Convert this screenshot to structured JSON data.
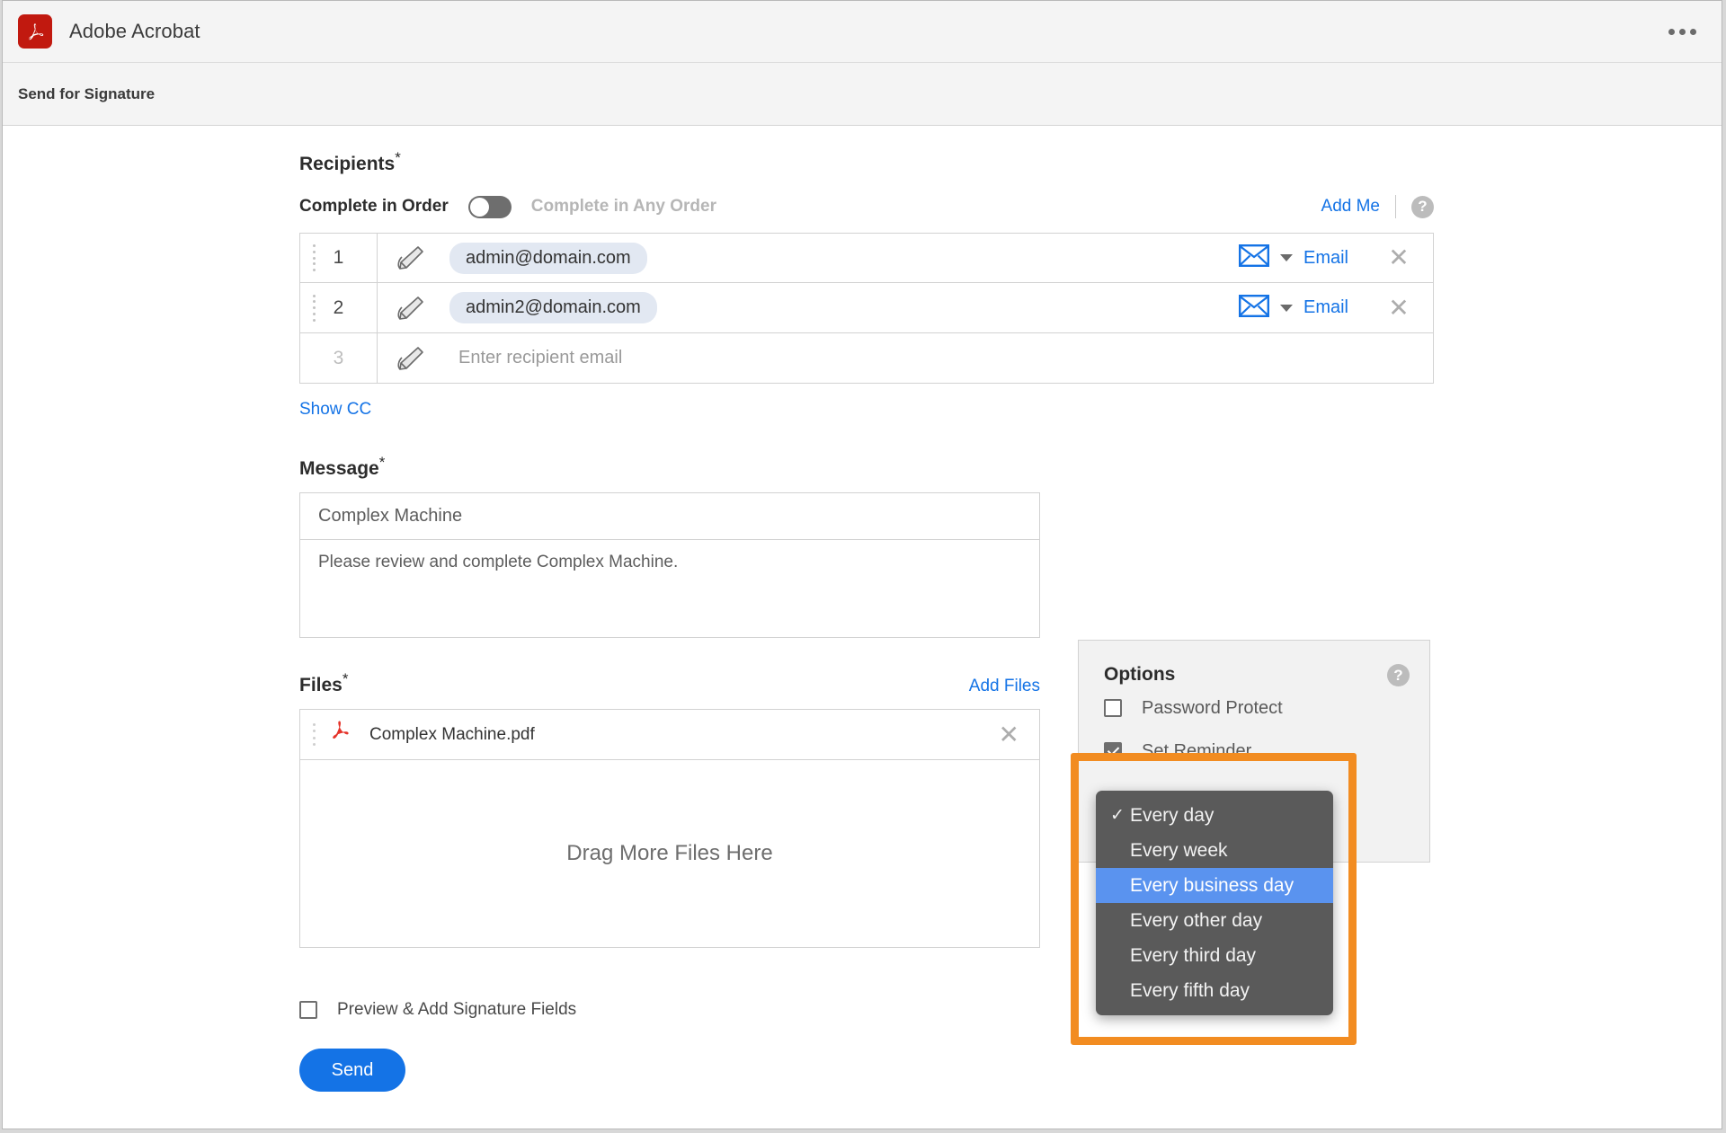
{
  "titlebar": {
    "app_title": "Adobe Acrobat",
    "logo_icon": "acrobat-logo-icon",
    "overflow_icon": "more-options-icon"
  },
  "subheader": {
    "title": "Send for Signature"
  },
  "recipients": {
    "label": "Recipients",
    "required_marker": "*",
    "order_toggle": {
      "on_label": "Complete in Order",
      "off_label": "Complete in Any Order",
      "state": "off"
    },
    "add_me_label": "Add Me",
    "help_glyph": "?",
    "rows": [
      {
        "number": "1",
        "email": "admin@domain.com",
        "is_placeholder": false,
        "method": "Email",
        "method_icon": "envelope-icon"
      },
      {
        "number": "2",
        "email": "admin2@domain.com",
        "is_placeholder": false,
        "method": "Email",
        "method_icon": "envelope-icon"
      },
      {
        "number": "3",
        "email": "Enter recipient email",
        "is_placeholder": true,
        "method": "",
        "method_icon": ""
      }
    ],
    "show_cc_label": "Show CC"
  },
  "message": {
    "label": "Message",
    "required_marker": "*",
    "subject": "Complex Machine",
    "body": "Please review and complete Complex Machine."
  },
  "files": {
    "label": "Files",
    "required_marker": "*",
    "add_files_label": "Add Files",
    "items": [
      {
        "name": "Complex Machine.pdf",
        "icon": "pdf-file-icon"
      }
    ],
    "drop_hint": "Drag More Files Here"
  },
  "footer": {
    "preview_label": "Preview & Add Signature Fields",
    "preview_checked": false,
    "send_label": "Send"
  },
  "options": {
    "title": "Options",
    "help_glyph": "?",
    "items": [
      {
        "label": "Password Protect",
        "checked": false
      },
      {
        "label": "Set Reminder",
        "checked": true
      }
    ]
  },
  "reminder_dropdown": {
    "checked_item": "Every day",
    "highlighted_item": "Every business day",
    "check_glyph": "✓",
    "items": [
      {
        "label": "Every day",
        "checked": true,
        "highlighted": false
      },
      {
        "label": "Every week",
        "checked": false,
        "highlighted": false
      },
      {
        "label": "Every business day",
        "checked": false,
        "highlighted": true
      },
      {
        "label": "Every other day",
        "checked": false,
        "highlighted": false
      },
      {
        "label": "Every third day",
        "checked": false,
        "highlighted": false
      },
      {
        "label": "Every fifth day",
        "checked": false,
        "highlighted": false
      }
    ]
  },
  "colors": {
    "accent_blue": "#1473e6",
    "highlight_orange": "#f28c21",
    "menu_background": "#5a5a5a",
    "menu_selection_blue": "#5a93ef",
    "acrobat_red": "#c1190f",
    "email_pill": "#e2e8f2"
  }
}
